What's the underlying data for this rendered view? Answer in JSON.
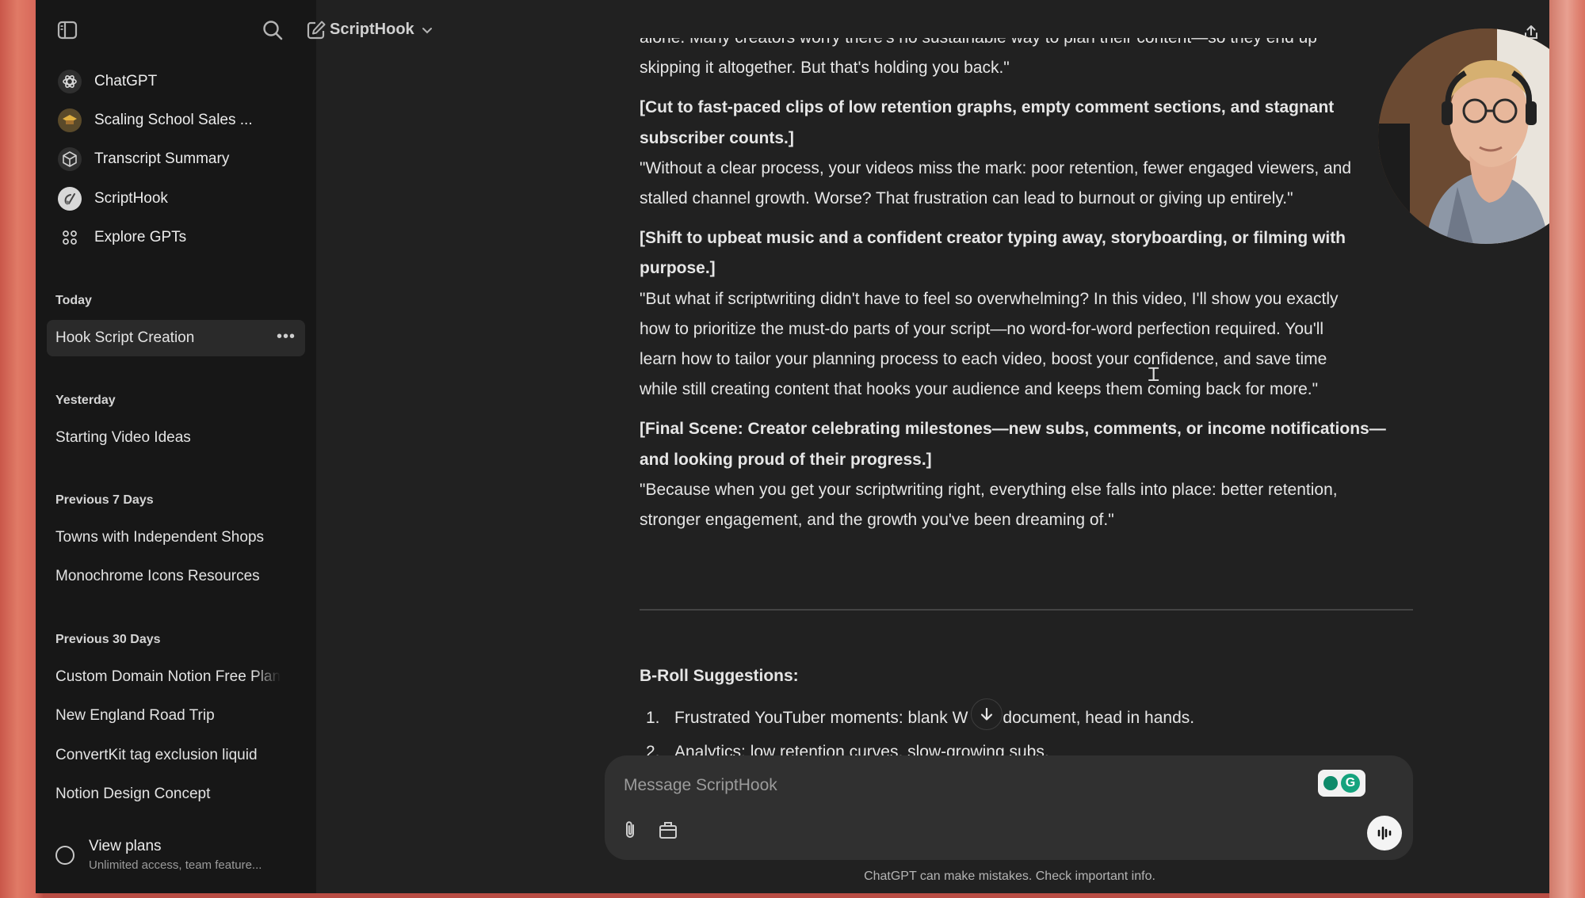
{
  "sidebar": {
    "gpts": [
      {
        "label": "ChatGPT",
        "icon": "openai-logo-icon"
      },
      {
        "label": "Scaling School Sales ...",
        "icon": "gpt-avatar-icon"
      },
      {
        "label": "Transcript Summary",
        "icon": "cube-icon"
      },
      {
        "label": "ScriptHook",
        "icon": "gpt-avatar-icon"
      },
      {
        "label": "Explore GPTs",
        "icon": "grid-icon"
      }
    ],
    "sections": [
      {
        "label": "Today",
        "items": [
          "Hook Script Creation"
        ]
      },
      {
        "label": "Yesterday",
        "items": [
          "Starting Video Ideas"
        ]
      },
      {
        "label": "Previous 7 Days",
        "items": [
          "Towns with Independent Shops",
          "Monochrome Icons Resources"
        ]
      },
      {
        "label": "Previous 30 Days",
        "items": [
          "Custom Domain Notion Free Plan",
          "New England Road Trip",
          "ConvertKit tag exclusion liquid",
          "Notion Design Concept"
        ]
      }
    ],
    "plans": {
      "title": "View plans",
      "subtitle": "Unlimited access, team feature..."
    }
  },
  "header": {
    "model": "ScriptHook"
  },
  "chat": {
    "lines": [
      {
        "text": "alone. Many creators worry there's no sustainable way to plan their content—so they end up",
        "bold": false
      },
      {
        "text": "skipping it altogether. But that's holding you back.\"",
        "bold": false
      },
      {
        "text": "[Cut to fast-paced clips of low retention graphs, empty comment sections, and stagnant",
        "bold": true,
        "gap": true
      },
      {
        "text": "subscriber counts.]",
        "bold": true
      },
      {
        "text": "\"Without a clear process, your videos miss the mark: poor retention, fewer engaged viewers, and",
        "bold": false
      },
      {
        "text": "stalled channel growth. Worse? That frustration can lead to burnout or giving up entirely.\"",
        "bold": false
      },
      {
        "text": "[Shift to upbeat music and a confident creator typing away, storyboarding, or filming with",
        "bold": true,
        "gap": true
      },
      {
        "text": "purpose.]",
        "bold": true
      },
      {
        "text": "\"But what if scriptwriting didn't have to feel so overwhelming? In this video, I'll show you exactly",
        "bold": false
      },
      {
        "text": "how to prioritize the must-do parts of your script—no word-for-word perfection required. You'll",
        "bold": false
      },
      {
        "text": "learn how to tailor your planning process to each video, boost your confidence, and save time",
        "bold": false
      },
      {
        "text": "while still creating content that hooks your audience and keeps them coming back for more.\"",
        "bold": false
      },
      {
        "text": "[Final Scene: Creator celebrating milestones—new subs, comments, or income notifications—",
        "bold": true,
        "gap": true
      },
      {
        "text": "and looking proud of their progress.]",
        "bold": true
      },
      {
        "text": "\"Because when you get your scriptwriting right, everything else falls into place: better retention,",
        "bold": false
      },
      {
        "text": "stronger engagement, and the growth you've been dreaming of.\"",
        "bold": false
      }
    ],
    "broll_title": "B-Roll Suggestions:",
    "broll_items": [
      {
        "n": "1.",
        "text": "Frustrated YouTuber moments: blank W",
        "text2": "document, head in hands."
      },
      {
        "n": "2.",
        "text": "Analytics: low retention curves, slow-growing subs."
      }
    ]
  },
  "composer": {
    "placeholder": "Message ScriptHook"
  },
  "footer_note": "ChatGPT can make mistakes. Check important info."
}
